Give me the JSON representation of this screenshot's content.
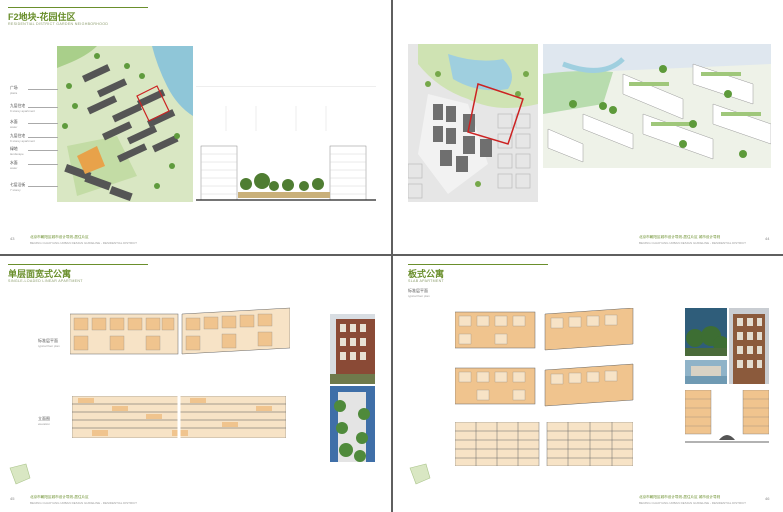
{
  "page1": {
    "title": "F2地块-花园住区",
    "subtitle": "RESIDENTIAL DISTRICT GARDEN NEIGHBORHOOD",
    "legend": [
      {
        "cn": "广场",
        "en": "plaza"
      },
      {
        "cn": "九层住宅",
        "en": "9 storey apartment"
      },
      {
        "cn": "水面",
        "en": "water"
      },
      {
        "cn": "九层住宅",
        "en": "9 storey apartment"
      },
      {
        "cn": "绿地",
        "en": "landscape"
      },
      {
        "cn": "水面",
        "en": "water"
      },
      {
        "cn": "七层沿街",
        "en": "7 storey"
      }
    ],
    "page_num": "43",
    "footer": "北京市朝阳区城市设计导则-居住片区",
    "footer_en": "BEIJING CHAOYANG URBAN DESIGN GUIDELINE - RESIDENTIAL DISTRICT"
  },
  "page2": {
    "page_num": "44",
    "footer": "北京市朝阳区城市设计导则-居住片区 城市设计导则",
    "footer_en": "BEIJING CHAOYANG URBAN DESIGN GUIDELINE - RESIDENTIAL DISTRICT"
  },
  "page3": {
    "title": "单层面宽式公寓",
    "subtitle": "SINGLE-LOADED LINEAR APARTMENT",
    "label1": "标准层平面",
    "label1_en": "typical floor plan",
    "label2": "立面图",
    "label2_en": "elevation",
    "page_num": "45",
    "footer": "北京市朝阳区城市设计导则-居住片区",
    "footer_en": "BEIJING CHAOYANG URBAN DESIGN GUIDELINE - RESIDENTIAL DISTRICT"
  },
  "page4": {
    "title": "板式公寓",
    "subtitle": "SLAB APARTMENT",
    "label1": "标准层平面",
    "label1_en": "typical floor plan",
    "page_num": "46",
    "footer": "北京市朝阳区城市设计导则-居住片区 城市设计导则",
    "footer_en": "BEIJING CHAOYANG URBAN DESIGN GUIDELINE - RESIDENTIAL DISTRICT"
  },
  "colors": {
    "accent": "#6a8f2c",
    "plan_orange": "#f0c48e",
    "plan_light": "#f7e3c6",
    "red_outline": "#cc2222"
  }
}
